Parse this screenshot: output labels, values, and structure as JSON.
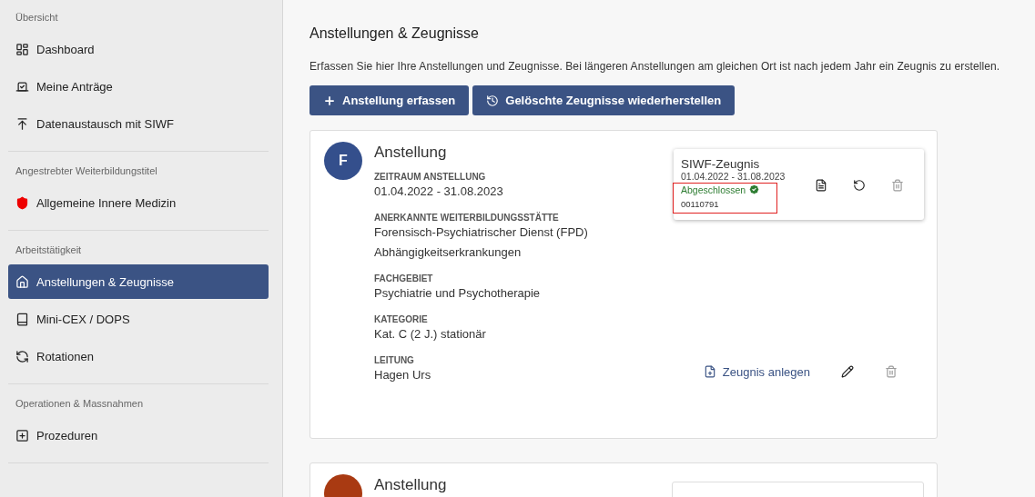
{
  "sidebar": {
    "sections": [
      {
        "title": "Übersicht",
        "items": [
          {
            "label": "Dashboard",
            "selected": false
          },
          {
            "label": "Meine Anträge",
            "selected": false
          },
          {
            "label": "Datenaustausch mit SIWF",
            "selected": false
          }
        ]
      },
      {
        "title": "Angestrebter Weiterbildungstitel",
        "items": [
          {
            "label": "Allgemeine Innere Medizin",
            "selected": false
          }
        ]
      },
      {
        "title": "Arbeitstätigkeit",
        "items": [
          {
            "label": "Anstellungen & Zeugnisse",
            "selected": true
          },
          {
            "label": "Mini-CEX / DOPS",
            "selected": false
          },
          {
            "label": "Rotationen",
            "selected": false
          }
        ]
      },
      {
        "title": "Operationen & Massnahmen",
        "items": [
          {
            "label": "Prozeduren",
            "selected": false
          }
        ]
      }
    ]
  },
  "page": {
    "title": "Anstellungen & Zeugnisse",
    "description": "Erfassen Sie hier Ihre Anstellungen und Zeugnisse. Bei längeren Anstellungen am gleichen Ort ist nach jedem Jahr ein Zeugnis zu erstellen.",
    "buttons": [
      "Anstellung erfassen",
      "Gelöschte Zeugnisse wiederherstellen"
    ]
  },
  "employments": [
    {
      "avatar": "F",
      "color": "#344f8c",
      "title": "Anstellung",
      "fields": [
        {
          "label": "ZEITRAUM ANSTELLUNG",
          "lines": [
            "01.04.2022 - 31.08.2023"
          ]
        },
        {
          "label": "ANERKANNTE WEITERBILDUNGSSTÄTTE",
          "lines": [
            "Forensisch-Psychiatrischer Dienst (FPD)",
            "Abhängigkeitserkrankungen"
          ]
        },
        {
          "label": "FACHGEBIET",
          "lines": [
            "Psychiatrie und Psychotherapie"
          ]
        },
        {
          "label": "KATEGORIE",
          "lines": [
            "Kat. C (2 J.) stationär"
          ]
        },
        {
          "label": "LEITUNG",
          "lines": [
            "Hagen Urs"
          ]
        }
      ],
      "certificate": {
        "title": "SIWF-Zeugnis",
        "period": "01.04.2022 - 31.08.2023",
        "status": "Abgeschlossen",
        "number": "00110791",
        "highlighted": true,
        "delete_disabled": true
      },
      "add_certificate": "Zeugnis anlegen",
      "delete_disabled": true
    },
    {
      "color": "#a93a12",
      "title": "Anstellung"
    }
  ]
}
